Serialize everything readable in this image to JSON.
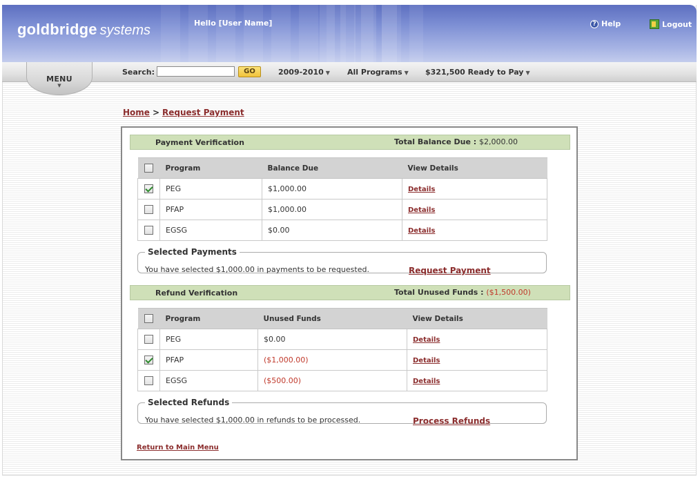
{
  "header": {
    "logo_bold": "goldbridge",
    "logo_light": "systems",
    "greeting": "Hello [User Name]",
    "help_label": "Help",
    "logout_label": "Logout"
  },
  "toolbar": {
    "menu_label": "MENU",
    "search_label": "Search:",
    "search_value": "",
    "go_label": "GO",
    "year": "2009-2010",
    "programs": "All Programs",
    "ready_to_pay": "$321,500 Ready to Pay"
  },
  "breadcrumb": {
    "home": "Home",
    "separator": ">",
    "current": "Request Payment"
  },
  "payment_verification": {
    "title": "Payment Verification",
    "total_label": "Total Balance Due :",
    "total_value": "$2,000.00",
    "columns": [
      "Program",
      "Balance Due",
      "View Details"
    ],
    "rows": [
      {
        "checked": true,
        "program": "PEG",
        "amount": "$1,000.00",
        "details": "Details"
      },
      {
        "checked": false,
        "program": "PFAP",
        "amount": "$1,000.00",
        "details": "Details"
      },
      {
        "checked": false,
        "program": "EGSG",
        "amount": "$0.00",
        "details": "Details"
      }
    ],
    "selected_legend": "Selected Payments",
    "selected_message": "You have selected $1,000.00 in payments to be requested.",
    "action_label": "Request Payment"
  },
  "refund_verification": {
    "title": "Refund Verification",
    "total_label": "Total Unused Funds :",
    "total_value": "($1,500.00)",
    "columns": [
      "Program",
      "Unused Funds",
      "View Details"
    ],
    "rows": [
      {
        "checked": false,
        "program": "PEG",
        "amount": "$0.00",
        "details": "Details"
      },
      {
        "checked": true,
        "program": "PFAP",
        "amount": "($1,000.00)",
        "details": "Details"
      },
      {
        "checked": false,
        "program": "EGSG",
        "amount": "($500.00)",
        "details": "Details"
      }
    ],
    "selected_legend": "Selected Refunds",
    "selected_message": "You have selected $1,000.00 in refunds to be processed.",
    "action_label": "Process Refunds"
  },
  "footer": {
    "return_link": "Return to Main Menu"
  },
  "colors": {
    "header_blue": "#7d8fd4",
    "section_green": "#cfe0b8",
    "link_maroon": "#8b2d2d",
    "negative_red": "#c0392b",
    "go_button_gold": "#f0c23a"
  }
}
